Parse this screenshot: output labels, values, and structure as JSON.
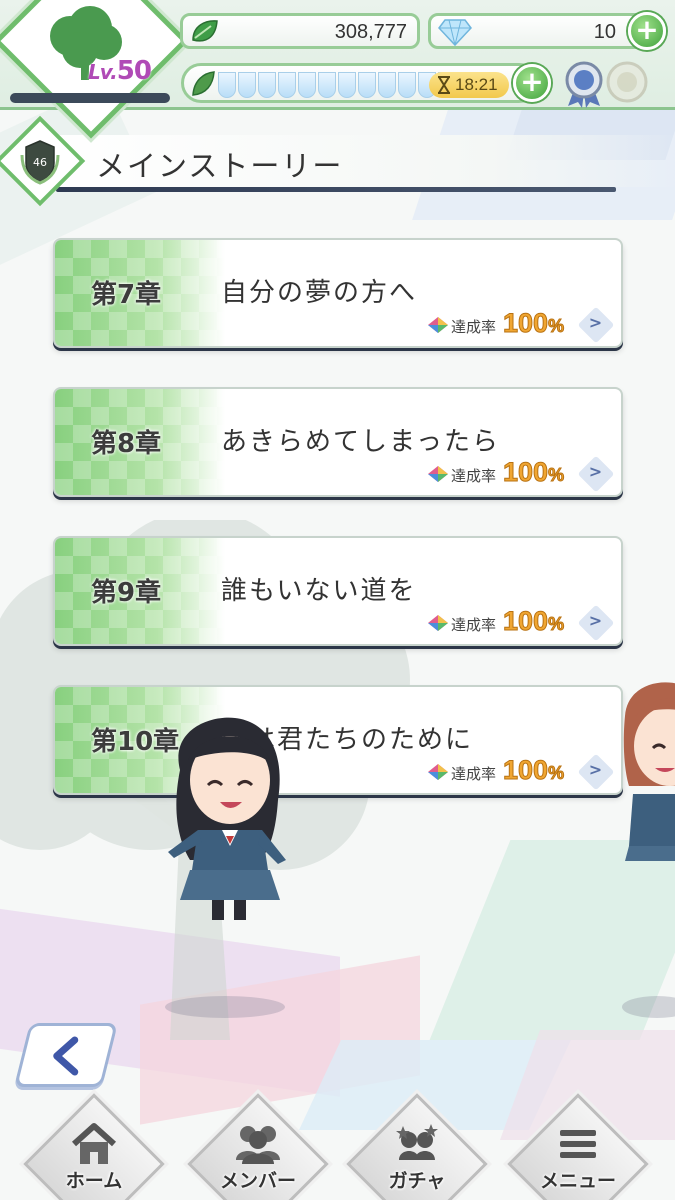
{
  "header": {
    "level_prefix": "Lv.",
    "level": "50",
    "coins": "308,777",
    "gems": "10",
    "stamina_timer": "18:21",
    "stamina_segments": 12,
    "xp_progress": 0.0,
    "colors": {
      "accent": "#6fbd6c",
      "level": "#b04ab6",
      "timer": "#f2c94c"
    }
  },
  "title": {
    "text": "メインストーリー"
  },
  "chapters": [
    {
      "number": "第7章",
      "title": "自分の夢の方へ",
      "rate_label": "達成率",
      "rate_value": "100",
      "rate_unit": "%"
    },
    {
      "number": "第8章",
      "title": "あきらめてしまったら",
      "rate_label": "達成率",
      "rate_value": "100",
      "rate_unit": "%"
    },
    {
      "number": "第9章",
      "title": "誰もいない道を",
      "rate_label": "達成率",
      "rate_value": "100",
      "rate_unit": "%"
    },
    {
      "number": "第10章",
      "title": "春は君たちのために",
      "rate_label": "達成率",
      "rate_value": "100",
      "rate_unit": "%"
    }
  ],
  "icons": {
    "back": "chevron-left-icon",
    "home": "home-icon",
    "members": "members-icon",
    "gacha": "gacha-icon",
    "menu": "menu-icon"
  },
  "bottom_nav": [
    {
      "label": "ホーム"
    },
    {
      "label": "メンバー"
    },
    {
      "label": "ガチャ"
    },
    {
      "label": "メニュー"
    }
  ]
}
